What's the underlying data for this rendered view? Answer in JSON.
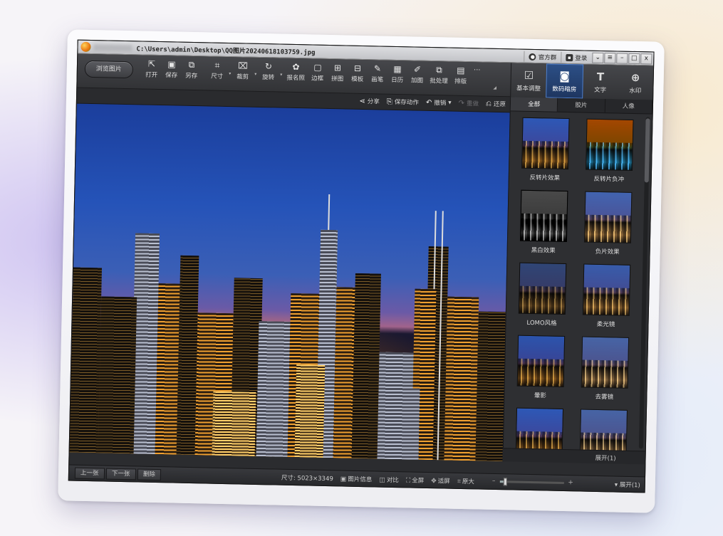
{
  "window": {
    "title_path": "C:\\Users\\admin\\Desktop\\QQ图片20240618103759.jpg",
    "links": [
      {
        "label": "官方群",
        "icon": "chat-icon"
      },
      {
        "label": "登录",
        "icon": "user-icon"
      }
    ],
    "controls": [
      "⌄",
      "≡",
      "–",
      "□",
      "x"
    ]
  },
  "toolbar": {
    "browse_label": "浏览图片",
    "tools": [
      {
        "label": "打开",
        "icon": "open-icon",
        "glyph": "⇱"
      },
      {
        "label": "保存",
        "icon": "save-icon",
        "glyph": "▣"
      },
      {
        "label": "另存",
        "icon": "save-as-icon",
        "glyph": "⧉"
      },
      {
        "label": "尺寸",
        "icon": "resize-icon",
        "glyph": "⌗"
      },
      {
        "label": "裁剪",
        "icon": "crop-icon",
        "glyph": "⌧"
      },
      {
        "label": "旋转",
        "icon": "rotate-icon",
        "glyph": "↻"
      },
      {
        "label": "报名照",
        "icon": "id-photo-icon",
        "glyph": "✿"
      },
      {
        "label": "边框",
        "icon": "border-icon",
        "glyph": "▢"
      },
      {
        "label": "拼图",
        "icon": "collage-icon",
        "glyph": "⊞"
      },
      {
        "label": "模板",
        "icon": "template-icon",
        "glyph": "⊟"
      },
      {
        "label": "画笔",
        "icon": "brush-icon",
        "glyph": "✎"
      },
      {
        "label": "日历",
        "icon": "calendar-icon",
        "glyph": "▦"
      },
      {
        "label": "加图",
        "icon": "add-image-icon",
        "glyph": "✐"
      },
      {
        "label": "批处理",
        "icon": "batch-icon",
        "glyph": "⧉"
      },
      {
        "label": "排版",
        "icon": "layout-icon",
        "glyph": "▤"
      }
    ],
    "more_label": "···"
  },
  "right_tabs": [
    {
      "label": "基本调整",
      "glyph": "☑",
      "icon": "adjust-icon",
      "active": false
    },
    {
      "label": "数码暗房",
      "glyph": "◙",
      "icon": "darkroom-icon",
      "active": true
    },
    {
      "label": "文字",
      "glyph": "T",
      "icon": "text-icon",
      "active": false
    },
    {
      "label": "水印",
      "glyph": "⊕",
      "icon": "watermark-icon",
      "active": false
    }
  ],
  "actions": [
    {
      "label": "分享",
      "glyph": "⋖",
      "icon": "share-icon",
      "enabled": true
    },
    {
      "label": "保存动作",
      "glyph": "⎘",
      "icon": "save-action-icon",
      "enabled": true
    },
    {
      "label": "撤销",
      "glyph": "↶",
      "icon": "undo-icon",
      "enabled": true
    },
    {
      "label": "重做",
      "glyph": "↷",
      "icon": "redo-icon",
      "enabled": false
    },
    {
      "label": "还原",
      "glyph": "⎌",
      "icon": "restore-icon",
      "enabled": true
    }
  ],
  "panel": {
    "tabs": [
      {
        "label": "全部",
        "active": true
      },
      {
        "label": "胶片",
        "active": false
      },
      {
        "label": "人像",
        "active": false
      }
    ],
    "effects": [
      {
        "label": "反转片效果",
        "style": "t-base"
      },
      {
        "label": "反转片负冲",
        "style": "t-inv"
      },
      {
        "label": "黑白效果",
        "style": "t-bw"
      },
      {
        "label": "负片效果",
        "style": "t-neg"
      },
      {
        "label": "LOMO风格",
        "style": "t-lomo"
      },
      {
        "label": "柔光镜",
        "style": "t-soft"
      },
      {
        "label": "暈影",
        "style": "t-shadow"
      },
      {
        "label": "去雾镜",
        "style": "t-fog"
      },
      {
        "label": "",
        "style": "t-base"
      },
      {
        "label": "",
        "style": "t-fog"
      }
    ],
    "expand_label": "展开(1)"
  },
  "statusbar": {
    "prev_label": "上一张",
    "next_label": "下一张",
    "delete_label": "删除",
    "size_text": "尺寸: 5023×3349",
    "info_items": [
      {
        "label": "图片信息",
        "glyph": "▣"
      },
      {
        "label": "对比",
        "glyph": "◫"
      },
      {
        "label": "全屏",
        "glyph": "⛶"
      },
      {
        "label": "适屏",
        "glyph": "✥"
      },
      {
        "label": "原大",
        "glyph": "⌗"
      }
    ],
    "zoom_minus": "–",
    "zoom_plus": "+",
    "zoom_level": 0.08,
    "expand_label": "展开(1)"
  }
}
